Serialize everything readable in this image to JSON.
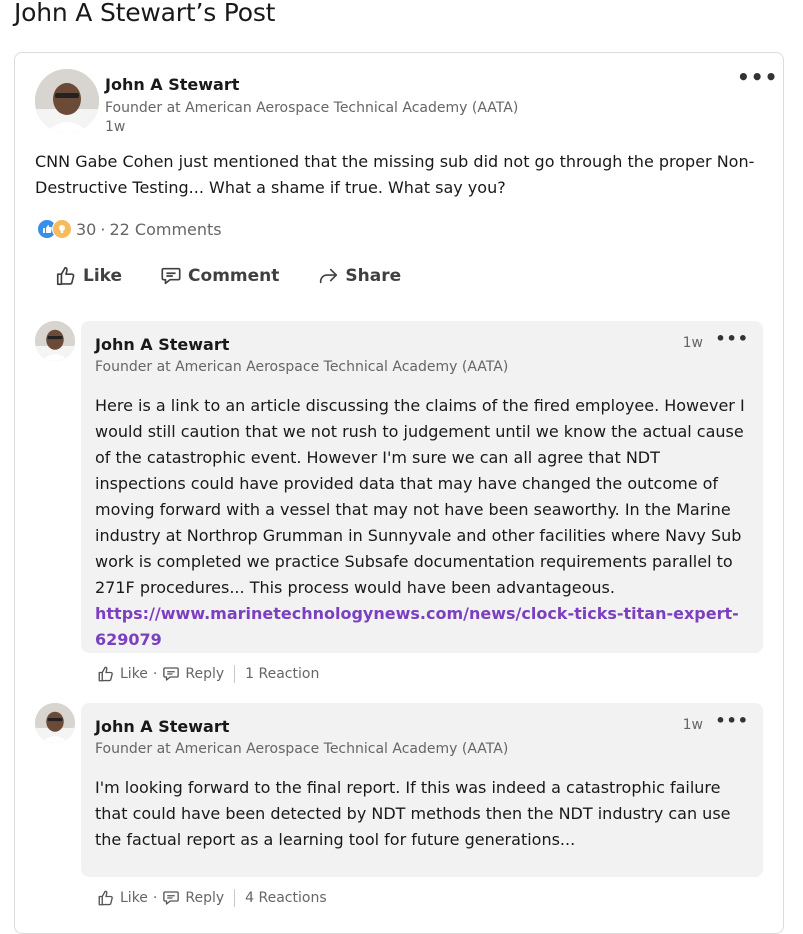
{
  "page": {
    "title": "John A Stewart’s Post"
  },
  "post": {
    "author": "John A Stewart",
    "headline": "Founder at American Aerospace Technical Academy (AATA)",
    "time": "1w",
    "more": "•••",
    "text": "CNN Gabe Cohen just mentioned that the missing sub did not go through the proper Non-Destructive Testing... What a shame if true. What say you?",
    "reaction_count": "30",
    "separator": "·",
    "comments_count": "22 Comments",
    "actions": {
      "like": "Like",
      "comment": "Comment",
      "share": "Share"
    }
  },
  "comments": [
    {
      "author": "John A Stewart",
      "headline": "Founder at American Aerospace Technical Academy (AATA)",
      "time": "1w",
      "more": "•••",
      "text": "Here is a link to an article discussing the claims of the fired employee. However I would still caution that we not rush to judgement until we know the actual cause of the catastrophic event. However I'm sure we can all agree that NDT inspections could have provided data that may have changed the outcome of moving forward with a vessel that may not have been seaworthy. In the Marine industry at Northrop Grumman in Sunnyvale and other facilities where Navy Sub work is completed we practice Subsafe documentation requirements parallel to 271F procedures... This process would have been advantageous.",
      "link": "https://www.marinetechnologynews.com/news/clock-ticks-titan-expert-629079",
      "like": "Like",
      "reply": "Reply",
      "reactions": "1 Reaction"
    },
    {
      "author": "John A Stewart",
      "headline": "Founder at American Aerospace Technical Academy (AATA)",
      "time": "1w",
      "more": "•••",
      "text": "I'm looking forward to the final report. If this was indeed a catastrophic failure that could have been detected by NDT methods then the NDT industry can use the factual report as a learning tool for future generations...",
      "like": "Like",
      "reply": "Reply",
      "reactions": "4 Reactions"
    }
  ],
  "icons": {
    "like": "thumbs-up-icon",
    "comment": "speech-bubble-icon",
    "share": "share-arrow-icon",
    "reaction_like": "like-reaction-icon",
    "reaction_idea": "insightful-reaction-icon"
  },
  "colors": {
    "link": "#7b3fbf",
    "comment_bg": "#f2f2f2",
    "like_reaction": "#378fe9",
    "idea_reaction": "#f5bb5c"
  }
}
